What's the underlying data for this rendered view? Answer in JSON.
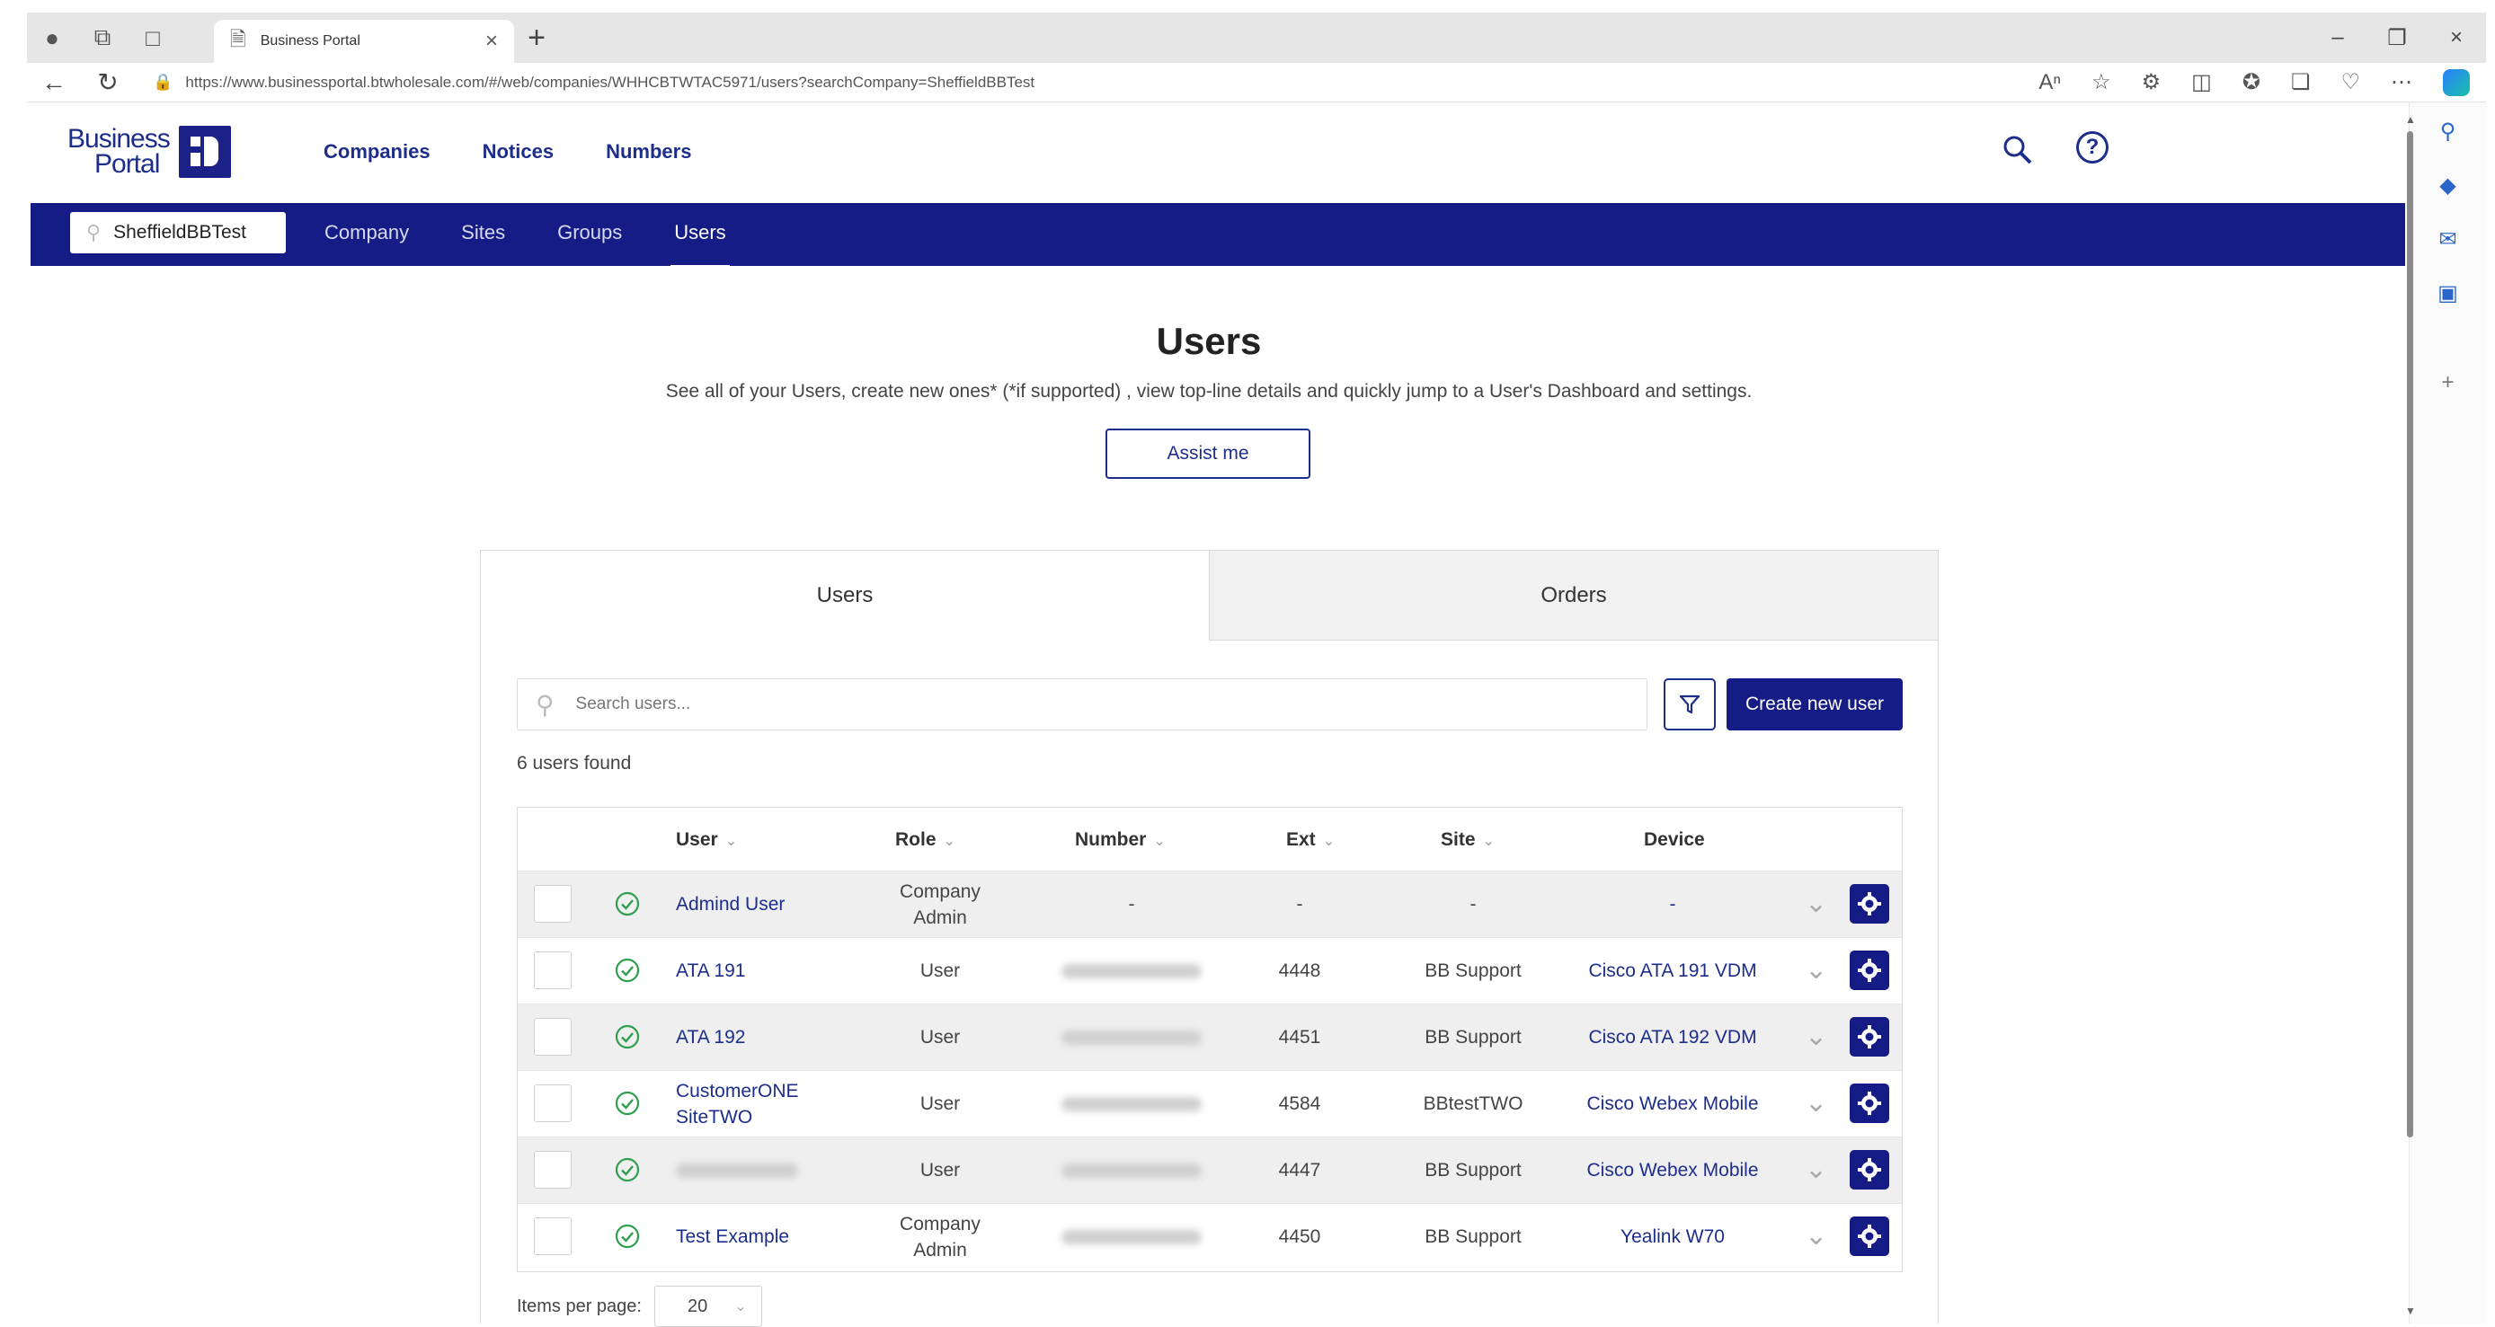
{
  "browser": {
    "tab_title": "Business Portal",
    "url": "https://www.businessportal.btwholesale.com/#/web/companies/WHHCBTWTAC5971/users?searchCompany=SheffieldBBTest"
  },
  "brand": {
    "line1": "Business",
    "line2": "Portal",
    "color": "#161c85"
  },
  "top_nav": {
    "companies": "Companies",
    "notices": "Notices",
    "numbers": "Numbers"
  },
  "sub_nav": {
    "company_search_value": "SheffieldBBTest",
    "company": "Company",
    "sites": "Sites",
    "groups": "Groups",
    "users": "Users"
  },
  "page": {
    "title": "Users",
    "description": "See all of your Users, create new ones* (*if supported) , view top-line details and quickly jump to a User's Dashboard and settings.",
    "assist_label": "Assist me"
  },
  "panel": {
    "tab_users": "Users",
    "tab_orders": "Orders",
    "search_placeholder": "Search users...",
    "create_label": "Create new user",
    "found_text": "6 users found"
  },
  "table": {
    "headers": {
      "user": "User",
      "role": "Role",
      "number": "Number",
      "ext": "Ext",
      "site": "Site",
      "device": "Device"
    },
    "rows": [
      {
        "user": "Admind User",
        "role_line1": "Company",
        "role_line2": "Admin",
        "number": "-",
        "ext": "-",
        "site": "-",
        "device": "-"
      },
      {
        "user": "ATA 191",
        "role_line1": "User",
        "role_line2": "",
        "number": "",
        "ext": "4448",
        "site": "BB Support",
        "device": "Cisco ATA 191 VDM"
      },
      {
        "user": "ATA 192",
        "role_line1": "User",
        "role_line2": "",
        "number": "",
        "ext": "4451",
        "site": "BB Support",
        "device": "Cisco ATA 192 VDM"
      },
      {
        "user": "CustomerONE SiteTWO",
        "role_line1": "User",
        "role_line2": "",
        "number": "",
        "ext": "4584",
        "site": "BBtestTWO",
        "device": "Cisco Webex Mobile"
      },
      {
        "user": "",
        "role_line1": "User",
        "role_line2": "",
        "number": "",
        "ext": "4447",
        "site": "BB Support",
        "device": "Cisco Webex Mobile"
      },
      {
        "user": "Test Example",
        "role_line1": "Company",
        "role_line2": "Admin",
        "number": "",
        "ext": "4450",
        "site": "BB Support",
        "device": "Yealink W70"
      }
    ]
  },
  "pagination": {
    "items_label": "Items per page:",
    "per_page": "20"
  },
  "colors": {
    "brand_navy": "#161c85",
    "status_ok": "#2e9e4f"
  }
}
